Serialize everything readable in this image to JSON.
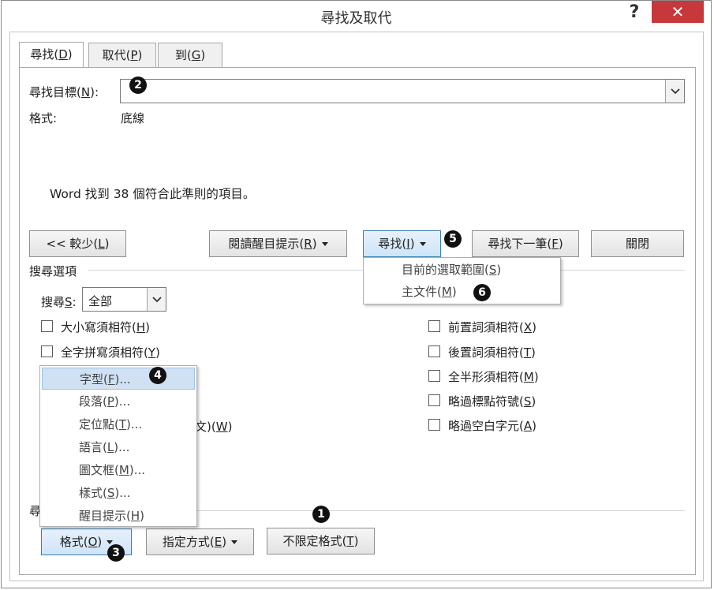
{
  "window": {
    "title": "尋找及取代",
    "help": "?",
    "close": "✕"
  },
  "tabs": [
    {
      "label": "尋找",
      "key": "D"
    },
    {
      "label": "取代",
      "key": "P"
    },
    {
      "label": "到",
      "key": "G"
    }
  ],
  "find": {
    "label": "尋找目標",
    "key": "N",
    "value": ""
  },
  "format": {
    "label": "格式:",
    "value": "底線"
  },
  "result_message": "Word 找到 38 個符合此準則的項目。",
  "buttons": {
    "less": {
      "label": "<< 較少",
      "key": "L"
    },
    "reading_highlight": {
      "label": "閱讀醒目提示",
      "key": "R"
    },
    "find_in": {
      "label": "尋找",
      "key": "I"
    },
    "find_next": {
      "label": "尋找下一筆",
      "key": "F"
    },
    "close": {
      "label": "關閉"
    },
    "format": {
      "label": "格式",
      "key": "O"
    },
    "special": {
      "label": "指定方式",
      "key": "E"
    },
    "no_formatting": {
      "label": "不限定格式",
      "key": "T"
    }
  },
  "find_in_menu": [
    {
      "label": "目前的選取範圍",
      "key": "S"
    },
    {
      "label": "主文件",
      "key": "M"
    }
  ],
  "search_options": {
    "title": "搜尋選項",
    "search_label": "搜尋",
    "search_key": "S",
    "search_value": "全部",
    "left": [
      {
        "label": "大小寫須相符",
        "key": "H",
        "checked": false
      },
      {
        "label": "全字拼寫須相符",
        "key": "Y",
        "checked": false
      }
    ],
    "left_partial": {
      "label": "文)",
      "key": "W"
    },
    "right": [
      {
        "label": "前置詞須相符",
        "key": "X",
        "checked": false
      },
      {
        "label": "後置詞須相符",
        "key": "T",
        "checked": false
      },
      {
        "label": "全半形須相符",
        "key": "M",
        "checked": false
      },
      {
        "label": "略過標點符號",
        "key": "S",
        "checked": false
      },
      {
        "label": "略過空白字元",
        "key": "A",
        "checked": false
      }
    ]
  },
  "replace_section_partial": "尋",
  "format_menu": [
    {
      "label": "字型",
      "key": "F",
      "suffix": "..."
    },
    {
      "label": "段落",
      "key": "P",
      "suffix": "..."
    },
    {
      "label": "定位點",
      "key": "T",
      "suffix": "..."
    },
    {
      "label": "語言",
      "key": "L",
      "suffix": "..."
    },
    {
      "label": "圖文框",
      "key": "M",
      "suffix": "..."
    },
    {
      "label": "樣式",
      "key": "S",
      "suffix": "..."
    },
    {
      "label": "醒目提示",
      "key": "H",
      "suffix": ""
    }
  ],
  "callouts": [
    "1",
    "2",
    "3",
    "4",
    "5",
    "6"
  ]
}
